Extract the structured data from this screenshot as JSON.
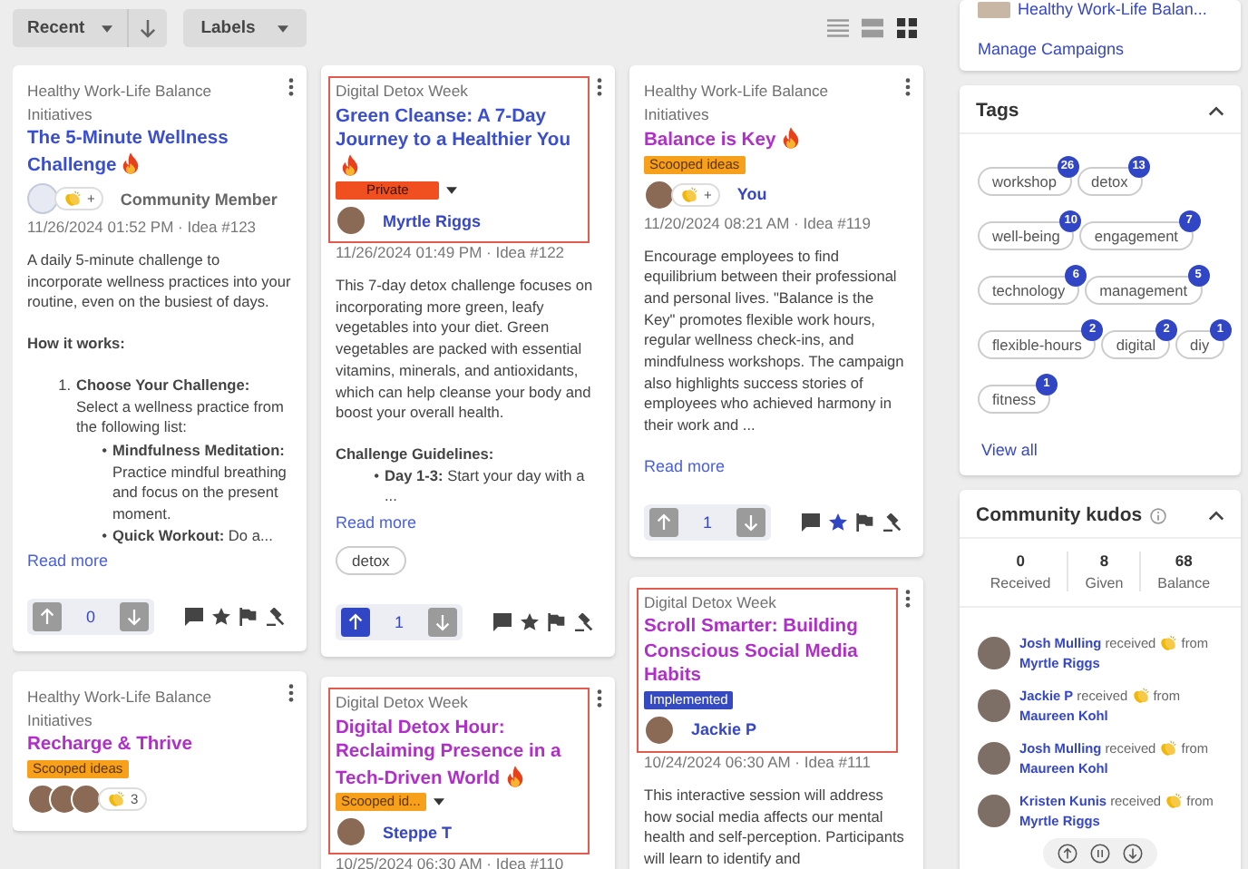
{
  "toolbar": {
    "sort": {
      "label": "Recent"
    },
    "labels": {
      "label": "Labels"
    },
    "views": [
      {
        "kind": "list",
        "selected": false
      },
      {
        "kind": "table",
        "selected": false
      },
      {
        "kind": "grid",
        "selected": true
      }
    ]
  },
  "columns": [
    {
      "cards": [
        {
          "campaign": "Healthy Work-Life Balance Initiatives",
          "title": "The 5-Minute Wellness Challenge",
          "color": "#3a4fcf",
          "fire": true,
          "highlighted": false,
          "author": {
            "avatars": [
              {
                "kind": "placeholder"
              }
            ],
            "kudos": "+",
            "name": "Community Member",
            "kind": "member"
          },
          "date": "11/26/2024 01:52 PM · Idea #123",
          "body": [
            {
              "kind": "p",
              "text": "A daily 5-minute challenge to incorporate wellness practices into your routine, even on the busiest of days."
            },
            {
              "kind": "p",
              "text": "**How it works:**"
            },
            {
              "kind": "list",
              "items": [
                {
                  "marker": "1.",
                  "text": "**Choose Your Challenge:** Select a wellness practice from the following list:",
                  "children": [
                    {
                      "marker": "•",
                      "text": "**Mindfulness Meditation:** Practice mindful breathing and focus on the present moment."
                    },
                    {
                      "marker": "•",
                      "text": "**Quick Workout:** Do a..."
                    }
                  ]
                }
              ]
            }
          ],
          "read_more": "Read more",
          "vote": {
            "up": false,
            "count": "0",
            "down": false
          },
          "starred": false
        },
        {
          "campaign": "Healthy Work-Life Balance Initiatives",
          "title": "Recharge & Thrive",
          "color": "#b02fc9",
          "fire": false,
          "highlighted": false,
          "label": {
            "text": "Scooped ideas",
            "kind": "scooped",
            "dropdown": false
          },
          "author": {
            "avatars": [
              {
                "kind": "photo"
              },
              {
                "kind": "photo"
              },
              {
                "kind": "photo"
              }
            ],
            "kudos": "3"
          }
        }
      ]
    },
    {
      "cards": [
        {
          "campaign": "Digital Detox Week",
          "title": "Green Cleanse: A 7-Day Journey to a Healthier You",
          "color": "#3a4fcf",
          "fire": true,
          "highlighted": true,
          "label": {
            "text": "Private",
            "kind": "private",
            "dropdown": true
          },
          "author": {
            "avatars": [
              {
                "kind": "photo"
              }
            ],
            "name": "Myrtle Riggs",
            "kind": "user"
          },
          "date": "11/26/2024 01:49 PM · Idea #122",
          "body": [
            {
              "kind": "p",
              "text": "This 7-day detox challenge focuses on incorporating more green, leafy vegetables into your diet. Green vegetables are packed with essential vitamins, minerals, and antioxidants, which can help cleanse your body and boost your overall health."
            },
            {
              "kind": "heading",
              "text": "Challenge Guidelines:"
            },
            {
              "kind": "list",
              "items": [
                {
                  "marker": "•",
                  "text": "**Day 1-3:** Start your day with a ..."
                }
              ]
            }
          ],
          "read_more": "Read more",
          "tags": [
            "detox"
          ],
          "vote": {
            "up": true,
            "count": "1",
            "down": false
          },
          "starred": false
        },
        {
          "campaign": "Digital Detox Week",
          "title": "Digital Detox Hour: Reclaiming Presence in a Tech-Driven World",
          "color": "#b02fc9",
          "fire": true,
          "highlighted": true,
          "label": {
            "text": "Scooped id...",
            "kind": "scooped",
            "dropdown": true
          },
          "author": {
            "avatars": [
              {
                "kind": "photo"
              }
            ],
            "name": "Steppe T",
            "kind": "user"
          },
          "date": "10/25/2024 06:30 AM · Idea #110"
        }
      ]
    },
    {
      "cards": [
        {
          "campaign": "Healthy Work-Life Balance Initiatives",
          "title": "Balance is Key",
          "color": "#b02fc9",
          "fire": true,
          "highlighted": false,
          "label": {
            "text": "Scooped ideas",
            "kind": "scooped",
            "dropdown": false
          },
          "author": {
            "avatars": [
              {
                "kind": "photo"
              }
            ],
            "kudos": "+",
            "name": "You",
            "kind": "user"
          },
          "date": "11/20/2024 08:21 AM · Idea #119",
          "body": [
            {
              "kind": "p",
              "text": "Encourage employees to find equilibrium between their professional and personal lives. \"Balance is the Key\" promotes flexible work hours, regular wellness check-ins, and mindfulness workshops. The campaign also highlights success stories of employees who achieved harmony in their work and ..."
            }
          ],
          "read_more": "Read more",
          "vote": {
            "up": false,
            "count": "1",
            "down": false
          },
          "starred": true
        },
        {
          "campaign": "Digital Detox Week",
          "title": "Scroll Smarter: Building Conscious Social Media Habits",
          "color": "#b02fc9",
          "fire": false,
          "highlighted": true,
          "label": {
            "text": "Implemented",
            "kind": "implemented",
            "dropdown": false
          },
          "author": {
            "avatars": [
              {
                "kind": "photo"
              }
            ],
            "name": "Jackie P",
            "kind": "user"
          },
          "date": "10/24/2024 06:30 AM · Idea #111",
          "body": [
            {
              "kind": "p",
              "text": "This interactive session will address how social media affects our mental health and self-perception. Participants will learn to identify and"
            }
          ]
        }
      ]
    }
  ],
  "sidebar": {
    "campaigns": {
      "items": [
        {
          "title": "Healthy Work-Life Balan..."
        }
      ],
      "manage": "Manage Campaigns"
    },
    "tags": {
      "title": "Tags",
      "expanded": true,
      "items": [
        {
          "name": "workshop",
          "count": "26"
        },
        {
          "name": "detox",
          "count": "13"
        },
        {
          "name": "well-being",
          "count": "10"
        },
        {
          "name": "engagement",
          "count": "7"
        },
        {
          "name": "technology",
          "count": "6"
        },
        {
          "name": "management",
          "count": "5"
        },
        {
          "name": "flexible-hours",
          "count": "2"
        },
        {
          "name": "digital",
          "count": "2"
        },
        {
          "name": "diy",
          "count": "1"
        },
        {
          "name": "fitness",
          "count": "1"
        }
      ],
      "view_all": "View all"
    },
    "kudos": {
      "title": "Community kudos",
      "expanded": true,
      "stats": [
        {
          "value": "0",
          "label": "Received"
        },
        {
          "value": "8",
          "label": "Given"
        },
        {
          "value": "68",
          "label": "Balance"
        }
      ],
      "feed": [
        {
          "recipient": "Josh Mulling",
          "verb": "received",
          "preposition": "from",
          "sender": "Myrtle Riggs"
        },
        {
          "recipient": "Jackie P",
          "verb": "received",
          "preposition": "from",
          "sender": "Maureen Kohl"
        },
        {
          "recipient": "Josh Mulling",
          "verb": "received",
          "preposition": "from",
          "sender": "Maureen Kohl"
        },
        {
          "recipient": "Kristen Kunis",
          "verb": "received",
          "preposition": "from",
          "sender": "Myrtle Riggs"
        }
      ],
      "paused": false
    }
  }
}
